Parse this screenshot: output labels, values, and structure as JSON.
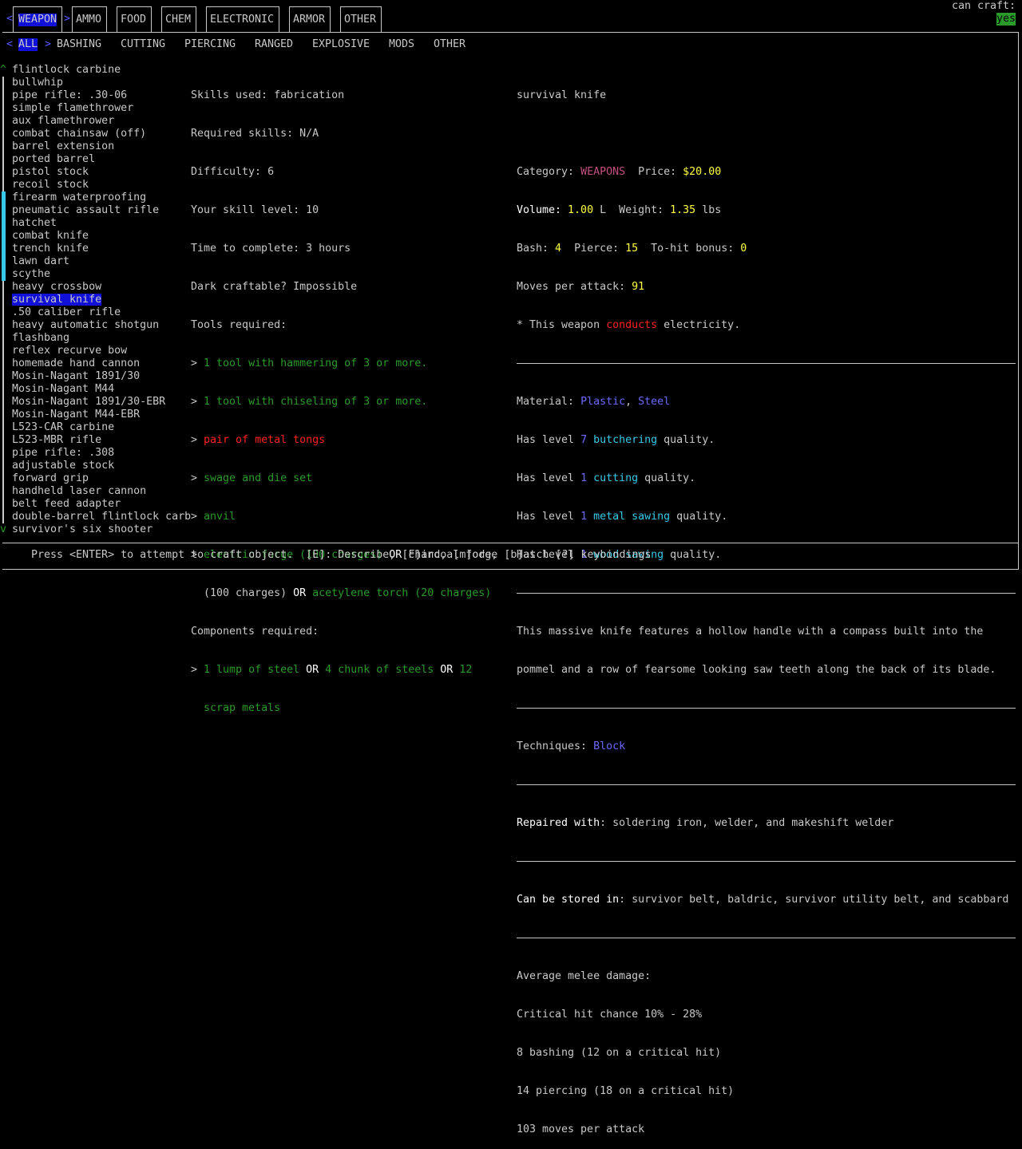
{
  "top_tabs": [
    {
      "label": "WEAPON",
      "selected": true
    },
    {
      "label": "AMMO",
      "selected": false
    },
    {
      "label": "FOOD",
      "selected": false
    },
    {
      "label": "CHEM",
      "selected": false
    },
    {
      "label": "ELECTRONIC",
      "selected": false
    },
    {
      "label": "ARMOR",
      "selected": false
    },
    {
      "label": "OTHER",
      "selected": false
    }
  ],
  "can_craft": {
    "label": "can craft:",
    "value": "yes"
  },
  "sub_tabs": [
    {
      "label": "ALL",
      "selected": true
    },
    {
      "label": "BASHING"
    },
    {
      "label": "CUTTING"
    },
    {
      "label": "PIERCING"
    },
    {
      "label": "RANGED"
    },
    {
      "label": "EXPLOSIVE"
    },
    {
      "label": "MODS"
    },
    {
      "label": "OTHER"
    }
  ],
  "nav_arrows": {
    "left": "<",
    "right": ">",
    "scroll_up": "^",
    "scroll_down": "v"
  },
  "recipes": [
    "flintlock carbine",
    "bullwhip",
    "pipe rifle: .30-06",
    "simple flamethrower",
    "aux flamethrower",
    "combat chainsaw (off)",
    "barrel extension",
    "ported barrel",
    "pistol stock",
    "recoil stock",
    "firearm waterproofing",
    "pneumatic assault rifle",
    "hatchet",
    "combat knife",
    "trench knife",
    "lawn dart",
    "scythe",
    "heavy crossbow",
    "survival knife",
    ".50 caliber rifle",
    "heavy automatic shotgun",
    "flashbang",
    "reflex recurve bow",
    "homemade hand cannon",
    "Mosin-Nagant 1891/30",
    "Mosin-Nagant M44",
    "Mosin-Nagant 1891/30-EBR",
    "Mosin-Nagant M44-EBR",
    "L523-CAR carbine",
    "L523-MBR rifle",
    "pipe rifle: .308",
    "adjustable stock",
    "forward grip",
    "handheld laser cannon",
    "belt feed adapter",
    "double-barrel flintlock carb",
    "survivor's six shooter"
  ],
  "selected_recipe_index": 18,
  "req": {
    "skills_used": "Skills used: fabrication",
    "required_skills": "Required skills: N/A",
    "difficulty": "Difficulty: 6",
    "skill_level": "Your skill level: 10",
    "time": "Time to complete: 3 hours",
    "dark": "Dark craftable? Impossible",
    "tools_header": "Tools required:",
    "bullet": ">",
    "tool1": "1 tool with hammering of 3 or more.",
    "tool2": "1 tool with chiseling of 3 or more.",
    "tool3": "pair of metal tongs",
    "tool4": "swage and die set",
    "tool5": "anvil",
    "forge_a": "electric forge (100 charges)",
    "or": "OR",
    "forge_b": "charcoal forge",
    "forge_b2": "(100 charges)",
    "forge_c": "acetylene torch (20 charges)",
    "components_header": "Components required:",
    "comp_a": "1 lump of steel",
    "comp_b": "4 chunk of steels",
    "comp_c1": "12",
    "comp_c2": "scrap metals"
  },
  "info": {
    "name": "survival knife",
    "category_label": "Category: ",
    "category": "WEAPONS",
    "price_label": "  Price: ",
    "price": "$20.00",
    "volume_label": "Volume: ",
    "volume": "1.00",
    "volume_unit": " L  Weight: ",
    "weight": "1.35",
    "weight_unit": " lbs",
    "bash_label": "Bash: ",
    "bash": "4",
    "pierce_label": "  Pierce: ",
    "pierce": "15",
    "tohit_label": "  To-hit bonus: ",
    "tohit": "0",
    "moves_label": "Moves per attack: ",
    "moves": "91",
    "conducts_pre": "* This weapon ",
    "conducts": "conducts",
    "conducts_post": " electricity.",
    "material_label": "Material: ",
    "material1": "Plastic",
    "comma": ", ",
    "material2": "Steel",
    "q_pre": "Has level ",
    "q_post": " quality.",
    "qualities": [
      {
        "level": "7",
        "name": "butchering"
      },
      {
        "level": "1",
        "name": "cutting"
      },
      {
        "level": "1",
        "name": "metal sawing"
      },
      {
        "level": "1",
        "name": "wood sawing"
      }
    ],
    "desc1": "This massive knife features a hollow handle with a compass built into the",
    "desc2": "pommel and a row of fearsome looking saw teeth along the back of its blade.",
    "tech_label": "Techniques: ",
    "tech": "Block",
    "repaired_label": "Repaired with",
    "repaired": ": soldering iron, welder, and makeshift welder",
    "stored_label": "Can be stored in",
    "stored": ": survivor belt, baldric, survivor utility belt, and scabbard",
    "avg": "Average melee damage:",
    "crit": "Critical hit chance 10% - 28%",
    "bashing": "8 bashing (12 on a critical hit)",
    "piercing": "14 piercing (18 on a critical hit)",
    "mpa": "103 moves per attack"
  },
  "footer": "Press <ENTER> to attempt to craft object.  [E]: Describe, [F]ind, [m]ode, [b]atch [?] keybindings",
  "colors": {
    "bg": "#000000",
    "text": "#c8c8c8",
    "highlight": "#1010d8",
    "green": "#2a9a2a",
    "red": "#ff2020",
    "yellow": "#ffff40",
    "cyan": "#38c8e8",
    "blue": "#6a6aff",
    "magenta": "#c05080"
  }
}
